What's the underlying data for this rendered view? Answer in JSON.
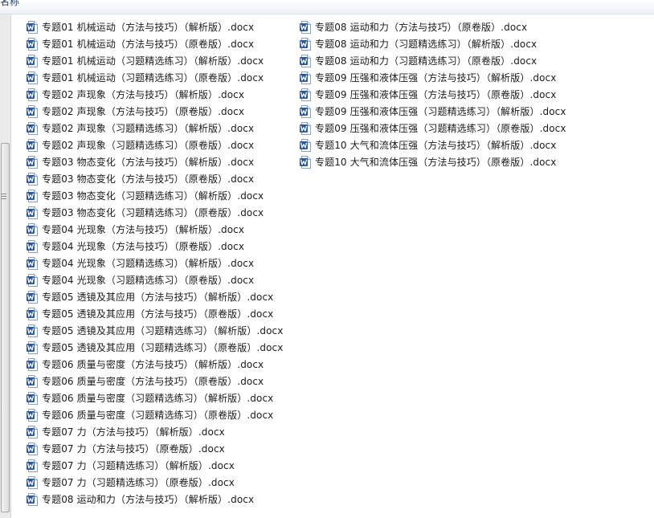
{
  "window": {
    "header_label": "名称"
  },
  "icons": {
    "file_icon": "word-docx-icon",
    "accent": "#2b579a"
  },
  "columns": [
    {
      "items": [
        "专题01 机械运动（方法与技巧）（解析版）.docx",
        "专题01 机械运动（方法与技巧）（原卷版）.docx",
        "专题01 机械运动（习题精选练习）（解析版）.docx",
        "专题01 机械运动（习题精选练习）（原卷版）.docx",
        "专题02 声现象（方法与技巧）（解析版）.docx",
        "专题02 声现象（方法与技巧）（原卷版）.docx",
        "专题02 声现象（习题精选练习）（解析版）.docx",
        "专题02 声现象（习题精选练习）（原卷版）.docx",
        "专题03 物态变化（方法与技巧）（解析版）.docx",
        "专题03 物态变化（方法与技巧）（原卷版）.docx",
        "专题03 物态变化（习题精选练习）（解析版）.docx",
        "专题03 物态变化（习题精选练习）（原卷版）.docx",
        "专题04 光现象（方法与技巧）（解析版）.docx",
        "专题04 光现象（方法与技巧）（原卷版）.docx",
        "专题04 光现象（习题精选练习）（解析版）.docx",
        "专题04 光现象（习题精选练习）（原卷版）.docx",
        "专题05 透镜及其应用（方法与技巧）（解析版）.docx",
        "专题05 透镜及其应用（方法与技巧）（原卷版）.docx",
        "专题05 透镜及其应用（习题精选练习）（解析版）.docx",
        "专题05 透镜及其应用（习题精选练习）（原卷版）.docx",
        "专题06 质量与密度（方法与技巧）（解析版）.docx",
        "专题06 质量与密度（方法与技巧）（原卷版）.docx",
        "专题06 质量与密度（习题精选练习）（解析版）.docx",
        "专题06 质量与密度（习题精选练习）（原卷版）.docx",
        "专题07 力（方法与技巧）（解析版）.docx",
        "专题07 力（方法与技巧）（原卷版）.docx",
        "专题07 力（习题精选练习）（解析版）.docx",
        "专题07 力（习题精选练习）（原卷版）.docx",
        "专题08 运动和力（方法与技巧）（解析版）.docx"
      ]
    },
    {
      "items": [
        "专题08 运动和力（方法与技巧）（原卷版）.docx",
        "专题08 运动和力（习题精选练习）（解析版）.docx",
        "专题08 运动和力（习题精选练习）（原卷版）.docx",
        "专题09 压强和液体压强（方法与技巧）（解析版）.docx",
        "专题09 压强和液体压强（方法与技巧）（原卷版）.docx",
        "专题09 压强和液体压强（习题精选练习）（解析版）.docx",
        "专题09 压强和液体压强（习题精选练习）（原卷版）.docx",
        "专题10 大气和流体压强（方法与技巧）（解析版）.docx",
        "专题10 大气和流体压强（方法与技巧）（原卷版）.docx"
      ]
    }
  ]
}
